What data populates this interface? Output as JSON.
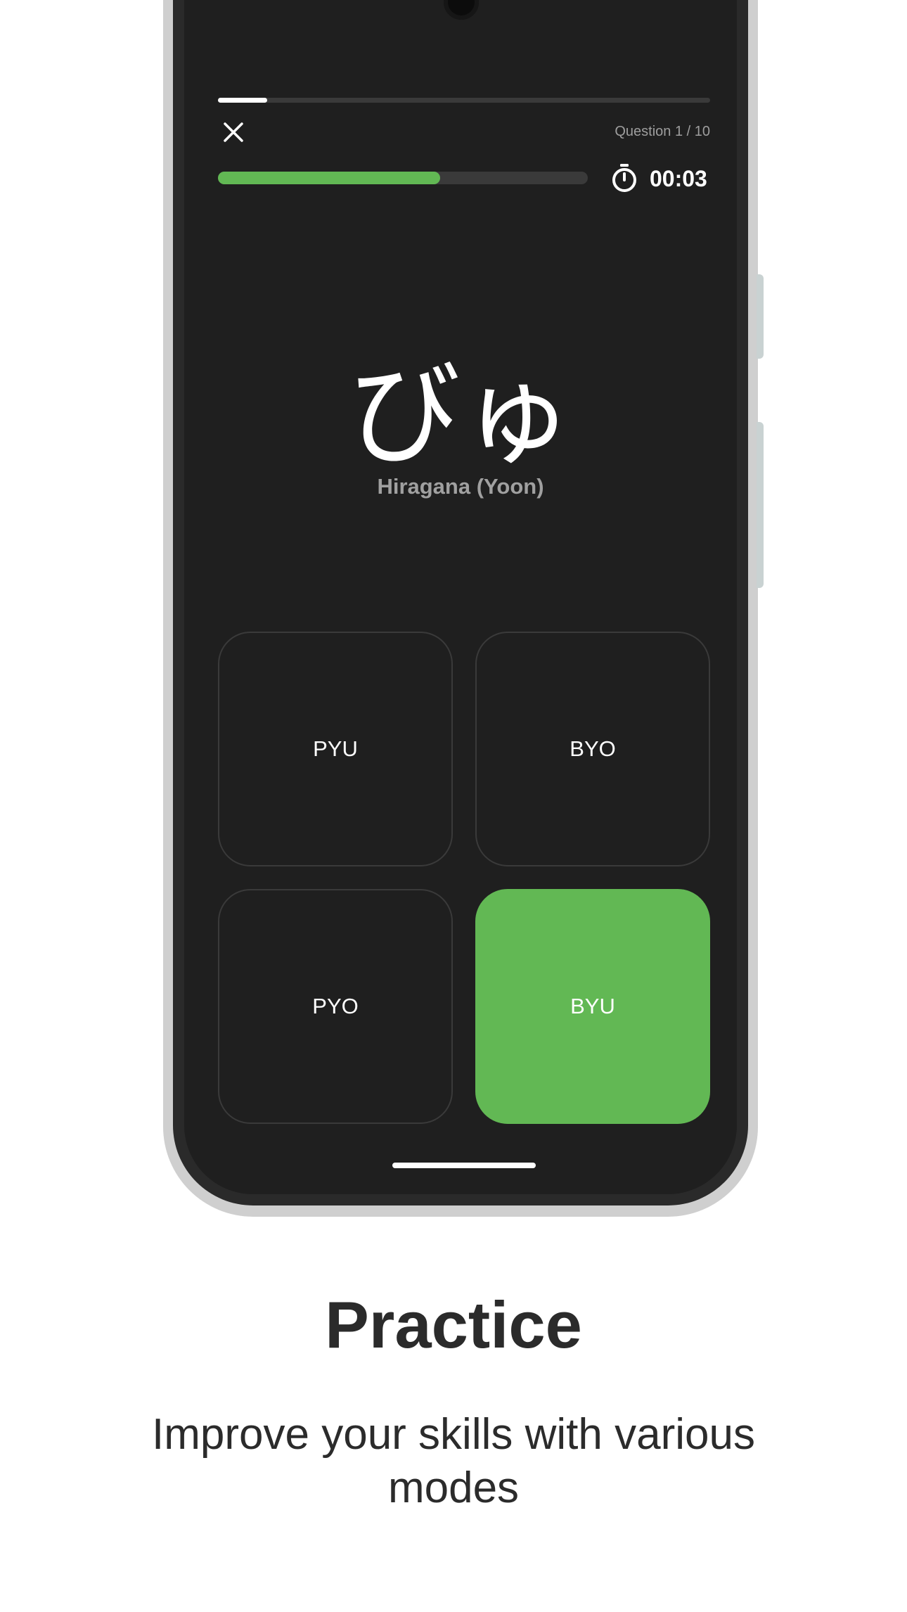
{
  "quiz": {
    "question_counter": "Question 1 / 10",
    "question_progress": 0.1,
    "timer_text": "00:03",
    "timer_progress": 0.6,
    "kana": "びゅ",
    "kana_type": "Hiragana (Yoon)",
    "answers": [
      {
        "label": "PYU",
        "state": "default"
      },
      {
        "label": "BYO",
        "state": "default"
      },
      {
        "label": "PYO",
        "state": "default"
      },
      {
        "label": "BYU",
        "state": "correct"
      }
    ]
  },
  "promo": {
    "headline": "Practice",
    "subline": "Improve your skills with various modes"
  },
  "icons": {
    "close": "close-icon",
    "timer": "stopwatch-icon"
  },
  "colors": {
    "accent_green": "#62b854",
    "screen_bg": "#1f1f1f",
    "track": "#3a3a3a"
  }
}
